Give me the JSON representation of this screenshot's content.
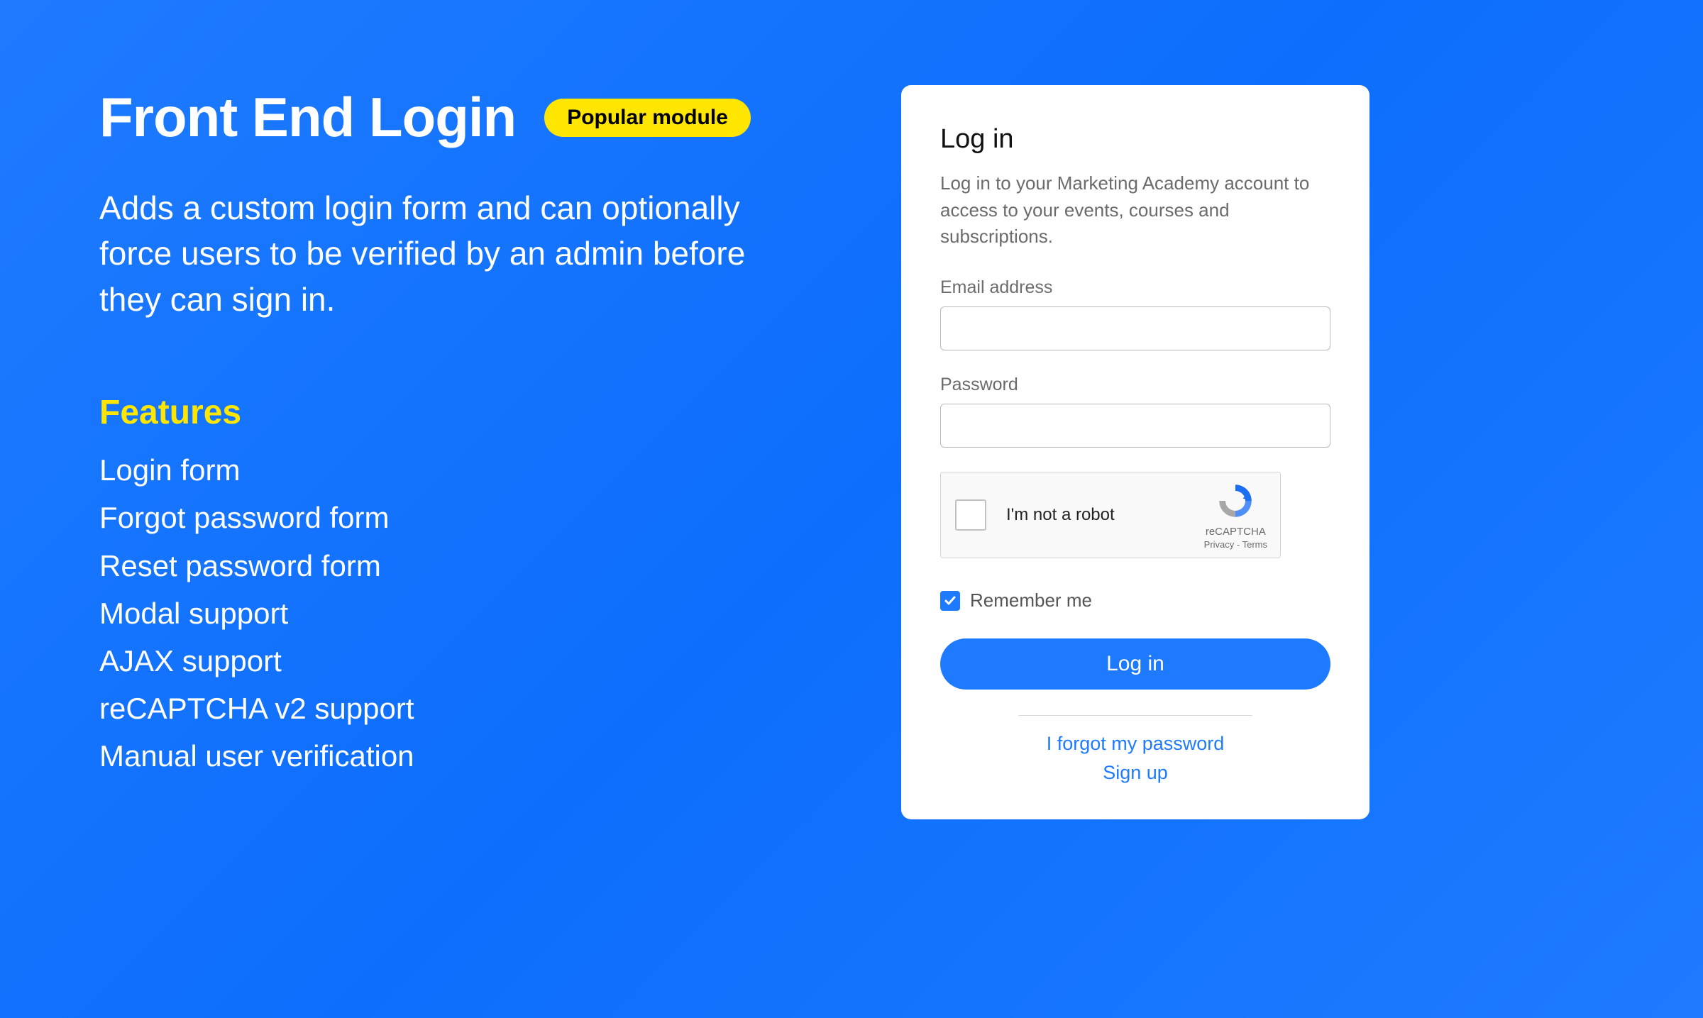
{
  "hero": {
    "title": "Front End Login",
    "badge": "Popular module",
    "description": "Adds a custom login form and can optionally force users to be verified by an admin before they can sign in.",
    "features_header": "Features",
    "features": [
      "Login form",
      "Forgot password form",
      "Reset password form",
      "Modal support",
      "AJAX support",
      "reCAPTCHA v2 support",
      "Manual user verification"
    ]
  },
  "login": {
    "title": "Log in",
    "subtitle": "Log in to your Marketing Academy account to access to your events, courses and subscriptions.",
    "email_label": "Email address",
    "email_value": "",
    "password_label": "Password",
    "password_value": "",
    "recaptcha": {
      "label": "I'm not a robot",
      "brand": "reCAPTCHA",
      "terms": "Privacy - Terms",
      "checked": false
    },
    "remember_label": "Remember me",
    "remember_checked": true,
    "submit_label": "Log in",
    "forgot_link": "I forgot my password",
    "signup_link": "Sign up"
  },
  "colors": {
    "accent": "#1e7bff",
    "highlight": "#ffe600"
  }
}
